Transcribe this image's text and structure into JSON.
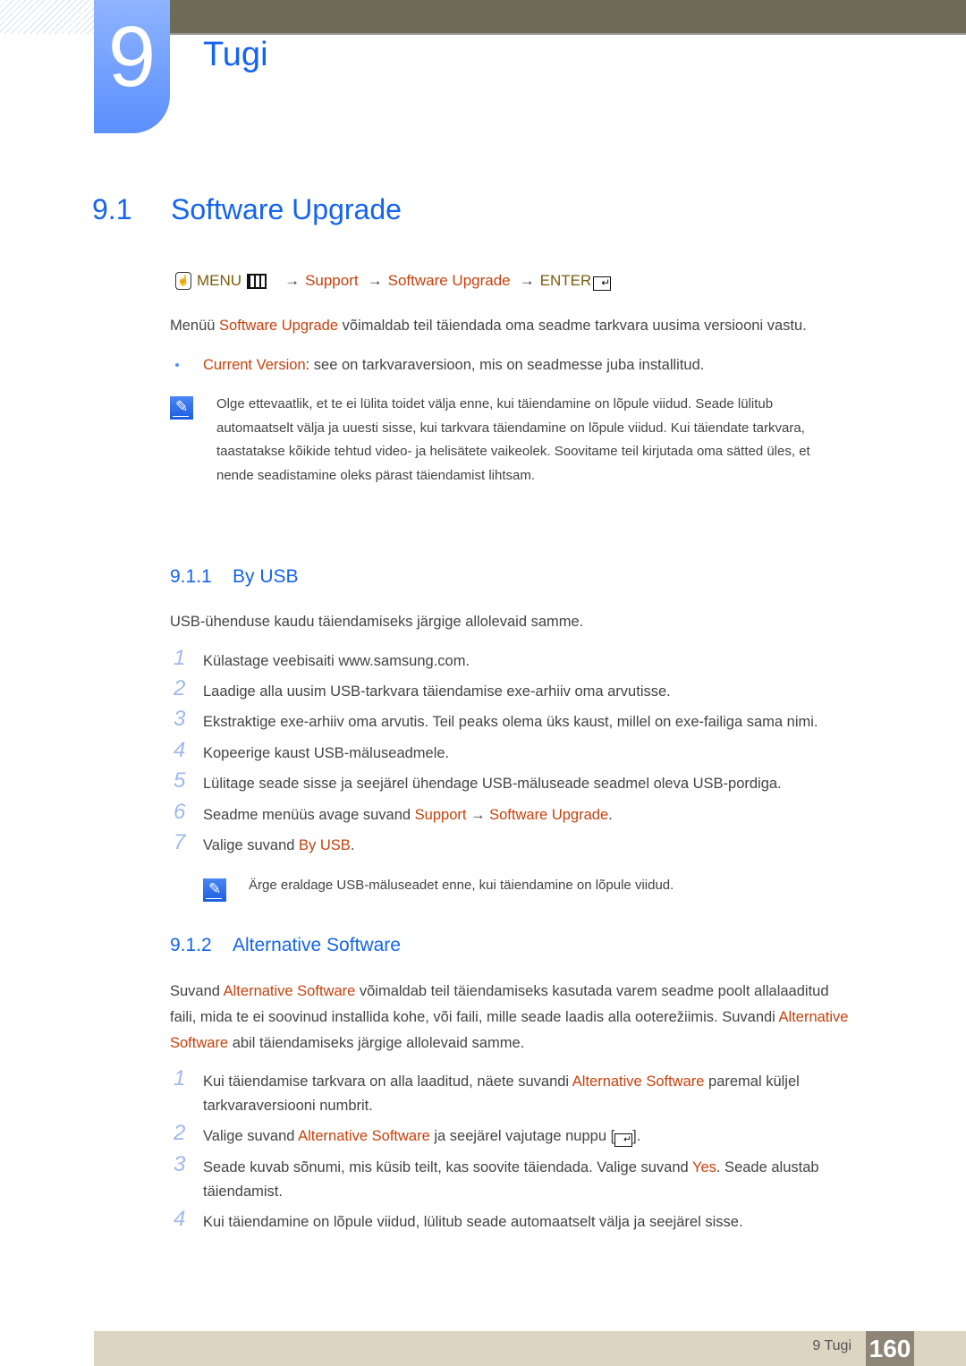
{
  "chapter": {
    "number": "9",
    "title": "Tugi"
  },
  "section": {
    "number": "9.1",
    "title": "Software Upgrade"
  },
  "menu_path": {
    "hand_icon": "remote-hand-icon",
    "menu_label": "MENU",
    "menu_icon": "menu-bars-icon",
    "arrow": "→",
    "support": "Support",
    "software_upgrade": "Software Upgrade",
    "enter_label": "ENTER",
    "enter_icon": "enter-icon"
  },
  "intro": {
    "prefix": "Menüü ",
    "highlight": "Software Upgrade",
    "suffix": " võimaldab teil täiendada oma seadme tarkvara uusima versiooni vastu."
  },
  "bullet": {
    "highlight": "Current Version",
    "text": ": see on tarkvaraversioon, mis on seadmesse juba installitud."
  },
  "note1": {
    "icon": "note-pencil-icon",
    "lines": [
      "Olge ettevaatlik, et te ei lülita toidet välja enne, kui täiendamine on lõpule viidud. Seade lülitub",
      "automaatselt välja ja uuesti sisse, kui tarkvara täiendamine on lõpule viidud. Kui täiendate tarkvara,",
      "taastatakse kõikide tehtud video- ja helisätete vaikeolek. Soovitame teil kirjutada oma sätted üles, et",
      "nende seadistamine oleks pärast täiendamist lihtsam."
    ]
  },
  "by_usb": {
    "number": "9.1.1",
    "title": "By USB",
    "intro": "USB-ühenduse kaudu täiendamiseks järgige allolevaid samme.",
    "steps": [
      {
        "num": "1",
        "text": "Külastage veebisaiti www.samsung.com."
      },
      {
        "num": "2",
        "text": "Laadige alla uusim USB-tarkvara täiendamise exe-arhiiv oma arvutisse."
      },
      {
        "num": "3",
        "text": "Ekstraktige exe-arhiiv oma arvutis. Teil peaks olema üks kaust, millel on exe-failiga sama nimi."
      },
      {
        "num": "4",
        "text": "Kopeerige kaust USB-mäluseadmele."
      },
      {
        "num": "5",
        "text": "Lülitage seade sisse ja seejärel ühendage USB-mäluseade seadmel oleva USB-pordiga."
      },
      {
        "num": "6",
        "prefix": "Seadme menüüs avage suvand ",
        "hl1": "Support",
        "arrow": " → ",
        "hl2": "Software Upgrade",
        "suffix": "."
      },
      {
        "num": "7",
        "prefix": "Valige suvand ",
        "hl1": "By USB",
        "suffix": "."
      }
    ],
    "note": {
      "icon": "note-pencil-icon",
      "text": "Ärge eraldage USB-mäluseadet enne, kui täiendamine on lõpule viidud."
    }
  },
  "alt_software": {
    "number": "9.1.2",
    "title": "Alternative Software",
    "intro": {
      "p1": "Suvand ",
      "hl1": "Alternative Software",
      "p2": " võimaldab teil täiendamiseks kasutada varem seadme poolt allalaaditud",
      "p3": "faili, mida te ei soovinud installida kohe, või faili, mille seade laadis alla ooterežiimis. Suvandi ",
      "hl2a": "Alternative",
      "hl2b": "Software",
      "p4": " abil täiendamiseks järgige allolevaid samme."
    },
    "steps": [
      {
        "num": "1",
        "prefix": "Kui täiendamise tarkvara on alla laaditud, näete suvandi ",
        "hl1": "Alternative Software",
        "suffix": " paremal küljel",
        "line2": "tarkvaraversiooni numbrit."
      },
      {
        "num": "2",
        "prefix": "Valige suvand ",
        "hl1": "Alternative Software",
        "suffix": " ja seejärel vajutage nuppu [",
        "icon": "enter-icon",
        "end": "]."
      },
      {
        "num": "3",
        "prefix": "Seade kuvab sõnumi, mis küsib teilt, kas soovite täiendada. Valige suvand ",
        "hl1": "Yes",
        "suffix": ". Seade alustab",
        "line2": "täiendamist."
      },
      {
        "num": "4",
        "text": "Kui täiendamine on lõpule viidud, lülitub seade automaatselt välja ja seejärel sisse."
      }
    ]
  },
  "footer": {
    "label": "9 Tugi",
    "page": "160"
  },
  "colors": {
    "heading_blue": "#1464f0",
    "highlight_orange": "#c8410c",
    "menu_gold": "#7d5c0c",
    "step_number": "#9fb8ef",
    "footer_bg": "#dcd5c1",
    "page_box": "#8e8578",
    "topbar": "#6e6b59"
  }
}
